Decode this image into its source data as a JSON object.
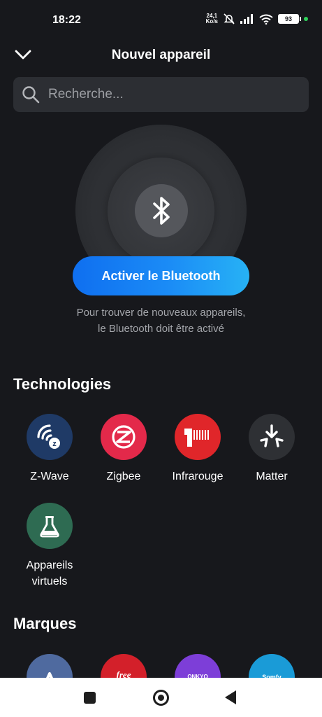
{
  "status_bar": {
    "time": "18:22",
    "net_speed_value": "24,1",
    "net_speed_unit": "Ko/s",
    "battery": "93",
    "icons": [
      "mute-icon",
      "signal-icon",
      "wifi-icon",
      "battery-icon"
    ]
  },
  "header": {
    "title": "Nouvel appareil",
    "back_icon": "chevron-down-icon"
  },
  "search": {
    "placeholder": "Recherche..."
  },
  "bluetooth": {
    "button_label": "Activer le Bluetooth",
    "hint_line1": "Pour trouver de nouveaux appareils,",
    "hint_line2": "le Bluetooth doit être activé",
    "icon": "bluetooth-icon"
  },
  "technologies": {
    "title": "Technologies",
    "items": [
      {
        "label": "Z-Wave",
        "color": "#1f3a66",
        "icon": "zwave-icon"
      },
      {
        "label": "Zigbee",
        "color": "#e3294a",
        "icon": "zigbee-icon"
      },
      {
        "label": "Infrarouge",
        "color": "#e0262a",
        "icon": "infrared-icon"
      },
      {
        "label": "Matter",
        "color": "#2e3034",
        "icon": "matter-icon"
      },
      {
        "label_line1": "Appareils",
        "label_line2": "virtuels",
        "color": "#2e6b52",
        "icon": "flask-icon"
      }
    ]
  },
  "brands": {
    "title": "Marques",
    "items": [
      {
        "name": "",
        "color": "#4f6a9f",
        "icon": "brand-logo-a"
      },
      {
        "name": "free",
        "color": "#d3202a"
      },
      {
        "name": "ONKYO",
        "color": "#7d3ed8"
      },
      {
        "name": "Somfy",
        "color": "#1a9bd7"
      }
    ]
  },
  "nav_bar": {
    "buttons": [
      "recent-apps-button",
      "home-button",
      "back-button"
    ]
  }
}
